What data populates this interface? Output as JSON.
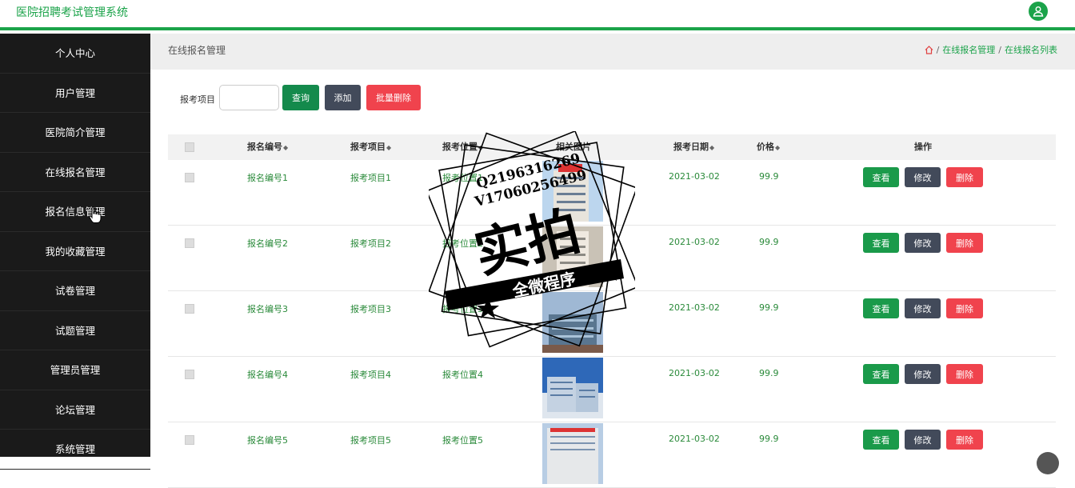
{
  "header": {
    "app_title": "医院招聘考试管理系统",
    "user_icon": "user-icon"
  },
  "sidebar": {
    "items": [
      {
        "label": "个人中心"
      },
      {
        "label": "用户管理"
      },
      {
        "label": "医院简介管理"
      },
      {
        "label": "在线报名管理"
      },
      {
        "label": "报名信息管理"
      },
      {
        "label": "我的收藏管理"
      },
      {
        "label": "试卷管理"
      },
      {
        "label": "试题管理"
      },
      {
        "label": "管理员管理"
      },
      {
        "label": "论坛管理"
      },
      {
        "label": "系统管理"
      }
    ]
  },
  "page": {
    "title": "在线报名管理",
    "breadcrumb": [
      "在线报名管理",
      "在线报名列表"
    ]
  },
  "search": {
    "label": "报考项目",
    "value": "",
    "placeholder": "",
    "query_label": "查询",
    "add_label": "添加",
    "batch_delete_label": "批量删除"
  },
  "table": {
    "columns": [
      "报名编号",
      "报考项目",
      "报考位置",
      "相关图片",
      "报考日期",
      "价格",
      "操作"
    ],
    "rows": [
      {
        "id": "报名编号1",
        "project": "报考项目1",
        "location": "报考位置1",
        "date": "2021-03-02",
        "price": "99.9"
      },
      {
        "id": "报名编号2",
        "project": "报考项目2",
        "location": "报考位置2",
        "date": "2021-03-02",
        "price": "99.9"
      },
      {
        "id": "报名编号3",
        "project": "报考项目3",
        "location": "报考位置3",
        "date": "2021-03-02",
        "price": "99.9"
      },
      {
        "id": "报名编号4",
        "project": "报考项目4",
        "location": "报考位置4",
        "date": "2021-03-02",
        "price": "99.9"
      },
      {
        "id": "报名编号5",
        "project": "报考项目5",
        "location": "报考位置5",
        "date": "2021-03-02",
        "price": "99.9"
      }
    ],
    "actions": {
      "view": "查看",
      "edit": "修改",
      "delete": "删除"
    }
  },
  "watermark": {
    "line1": "Q2196316269",
    "line2": "V17060256499",
    "big": "实拍",
    "banner": "全微程序"
  },
  "colors": {
    "accent": "#1ba34a",
    "sidebar_bg": "#1a1a1a",
    "danger": "#f0434d",
    "dark_button": "#424a5a"
  }
}
